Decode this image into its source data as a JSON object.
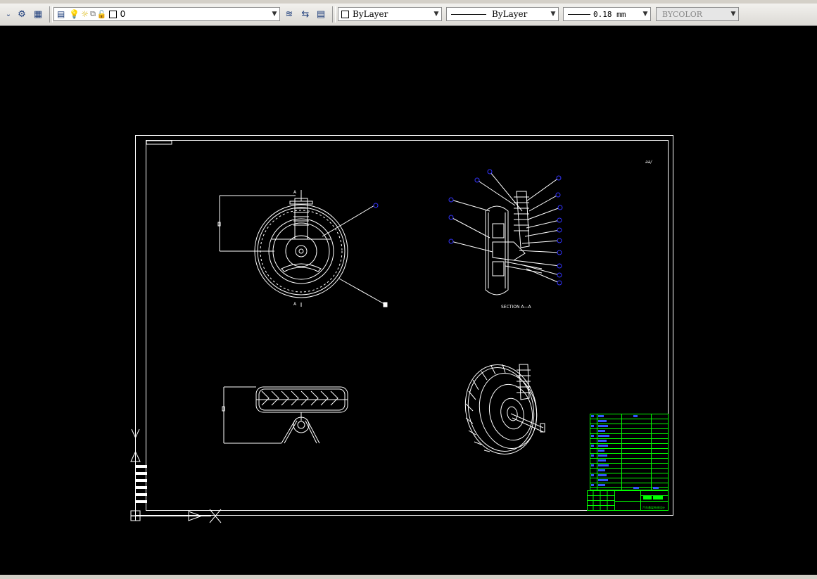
{
  "toolbar": {
    "layer_combo": {
      "value": "0"
    },
    "color_combo": {
      "value": "ByLayer"
    },
    "linetype_combo": {
      "value": "ByLayer"
    },
    "lineweight_combo": {
      "value": "0.18 mm"
    },
    "plotstyle_combo": {
      "value": "BYCOLOR"
    }
  },
  "drawing": {
    "section_label": "SECTION A—A",
    "scale_note": "aa/",
    "section_marks": [
      "A",
      "A"
    ],
    "title_text": "汽车悬架系统设计"
  },
  "colors": {
    "background": "#000000",
    "line": "#ffffff",
    "balloon": "#3333ff",
    "table": "#00ff00",
    "table_fill": "#3355ff"
  }
}
